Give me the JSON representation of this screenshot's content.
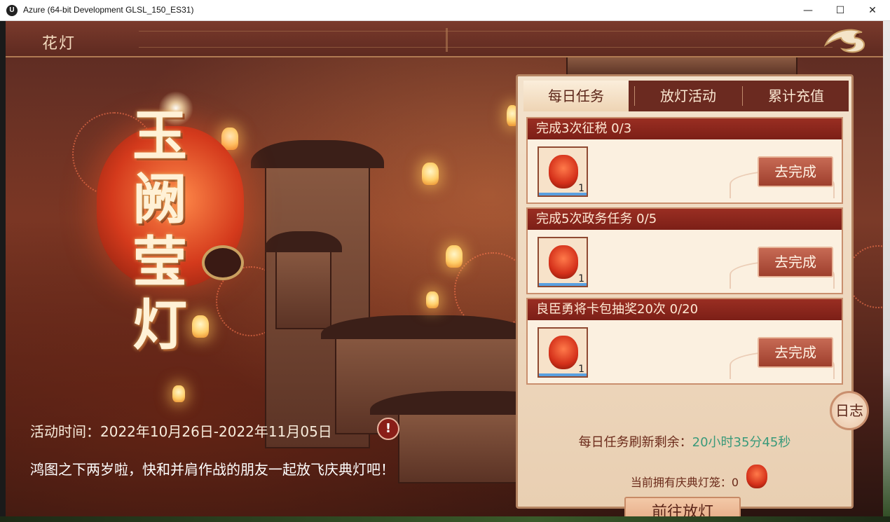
{
  "window": {
    "app_icon": "U",
    "title": "Azure (64-bit Development GLSL_150_ES31)",
    "min_glyph": "—",
    "max_glyph": "☐",
    "close_glyph": "✕"
  },
  "header": {
    "title": "花灯",
    "back_icon": "dragon-back-icon"
  },
  "title_art": {
    "text": "玉阙莹灯"
  },
  "event": {
    "time": "活动时间：2022年10月26日-2022年11月05日",
    "warn_glyph": "!",
    "description": "鸿图之下两岁啦，快和并肩作战的朋友一起放飞庆典灯吧！"
  },
  "tabs": [
    {
      "label": "每日任务",
      "active": true
    },
    {
      "label": "放灯活动",
      "active": false
    },
    {
      "label": "累计充值",
      "active": false
    }
  ],
  "tasks": [
    {
      "title": "完成3次征税  0/3",
      "reward_count": "1",
      "button": "去完成"
    },
    {
      "title": "完成5次政务任务  0/5",
      "reward_count": "1",
      "button": "去完成"
    },
    {
      "title": "良臣勇将卡包抽奖20次  0/20",
      "reward_count": "1",
      "button": "去完成"
    }
  ],
  "refresh": {
    "label": "每日任务刷新剩余：",
    "timer": "20小时35分45秒"
  },
  "own": {
    "label": "当前拥有庆典灯笼：0"
  },
  "release_button": "前往放灯",
  "log_button": "日志",
  "colors": {
    "accent_red": "#7c1f17",
    "panel_bg": "#f3e2cc",
    "timer_green": "#3a9a7a"
  }
}
